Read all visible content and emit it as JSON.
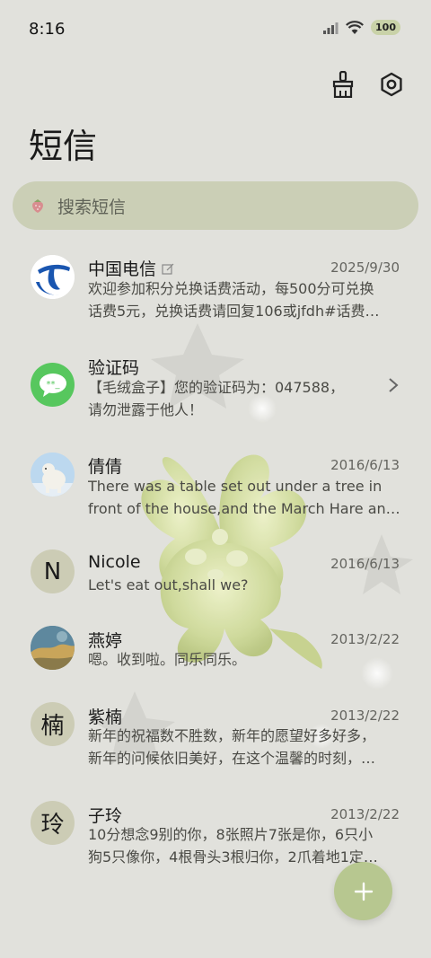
{
  "status_bar": {
    "time": "8:16",
    "battery": "100"
  },
  "header": {
    "title": "短信"
  },
  "search": {
    "placeholder": "搜索短信"
  },
  "messages": [
    {
      "name": "中国电信",
      "date": "2025/9/30",
      "line1": "欢迎参加积分兑换话费活动，每500分可兑换",
      "line2": "话费5元，兑换话费请回复106或jfdh#话费…",
      "avatar": "china-telecom-logo"
    },
    {
      "name": "验证码",
      "date": "",
      "line1": "【毛绒盒子】您的验证码为：047588，",
      "line2": "请勿泄露于他人！",
      "avatar": "sms-code-icon"
    },
    {
      "name": "倩倩",
      "date": "2016/6/13",
      "line1": "There was a table set out under a tree in",
      "line2": "front of the house,and the March Hare an…",
      "avatar": "polar-bear-photo"
    },
    {
      "name": "Nicole",
      "date": "2016/6/13",
      "line1": "Let's eat out,shall we?",
      "line2": "",
      "avatar_letter": "N"
    },
    {
      "name": "燕婷",
      "date": "2013/2/22",
      "line1": "嗯。收到啦。同乐同乐。",
      "line2": "",
      "avatar": "landscape-photo"
    },
    {
      "name": "紫楠",
      "date": "2013/2/22",
      "line1": "新年的祝福数不胜数，新年的愿望好多好多，",
      "line2": "新年的问候依旧美好，在这个温馨的时刻，…",
      "avatar_letter": "楠"
    },
    {
      "name": "子玲",
      "date": "2013/2/22",
      "line1": "10分想念9别的你，8张照片7张是你，6只小",
      "line2": "狗5只像你，4根骨头3根归你，2爪着地1定…",
      "avatar_letter": "玲"
    }
  ],
  "colors": {
    "background": "#e1e1dc",
    "accent": "#b7c790",
    "search_bg": "#c3c8aa"
  }
}
